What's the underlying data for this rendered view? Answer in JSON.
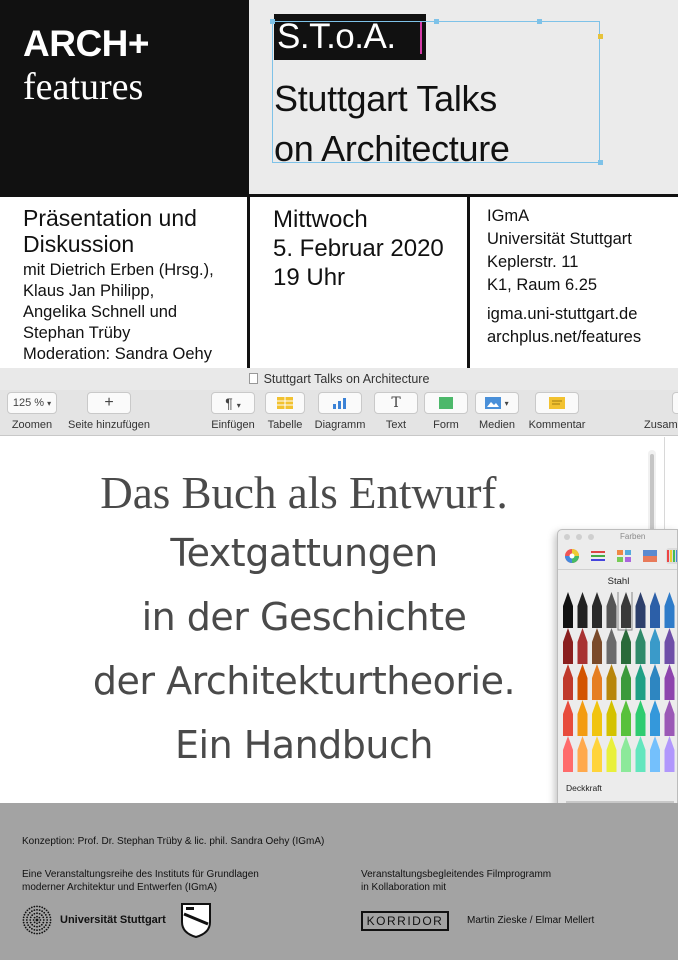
{
  "poster": {
    "brand": {
      "main": "ARCH+",
      "sub": "features"
    },
    "series": {
      "abbr": "S.T.o.A.",
      "title_lines": [
        "Stuttgart Talks",
        "on Architecture"
      ]
    },
    "col1": {
      "heading_lines": [
        "Präsentation und",
        "Diskussion"
      ],
      "people_lines": [
        "mit Dietrich Erben (Hrsg.),",
        "Klaus Jan Philipp,",
        "Angelika Schnell und",
        "Stephan Trüby",
        "Moderation: Sandra Oehy"
      ]
    },
    "col2": {
      "lines": [
        "Mittwoch",
        "5. Februar 2020",
        "19 Uhr"
      ]
    },
    "col3": {
      "address_lines": [
        "IGmA",
        "Universität Stuttgart",
        "Keplerstr. 11",
        "K1, Raum 6.25"
      ],
      "web_lines": [
        "igma.uni-stuttgart.de",
        "archplus.net/features"
      ]
    }
  },
  "app": {
    "window_title": "Stuttgart Talks on Architecture",
    "toolbar": {
      "zoom": {
        "value": "125 %",
        "label": "Zoomen"
      },
      "add_page": {
        "glyph": "+",
        "label": "Seite hinzufügen"
      },
      "insert": {
        "glyph": "¶",
        "label": "Einfügen"
      },
      "table": {
        "label": "Tabelle"
      },
      "chart": {
        "label": "Diagramm"
      },
      "text": {
        "glyph": "T",
        "label": "Text"
      },
      "shape": {
        "label": "Form"
      },
      "media": {
        "label": "Medien"
      },
      "comment": {
        "label": "Kommentar"
      },
      "collaborate": {
        "label": "Zusam"
      }
    },
    "colors": {
      "window_title": "Farben",
      "selected_name": "Stahl",
      "opacity_label": "Deckkraft",
      "accent": "#7ec2e8",
      "cursor": "#d33ba6"
    }
  },
  "book": {
    "title": "Das Buch als Entwurf.",
    "subtitle_lines": [
      "Textgattungen",
      "in der Geschichte",
      "der Architekturtheorie.",
      "Ein Handbuch"
    ]
  },
  "footer": {
    "concept": "Konzeption: Prof. Dr. Stephan Trüby & lic. phil. Sandra Oehy (IGmA)",
    "series_lines": [
      "Eine Veranstaltungsreihe des Instituts für Grundlagen",
      "moderner Architektur und Entwerfen (IGmA)"
    ],
    "film_lines": [
      "Veranstaltungsbegleitendes Filmprogramm",
      "in Kollaboration mit"
    ],
    "university": "Universität Stuttgart",
    "korridor": "KORRIDOR",
    "credits": "Martin Zieske / Elmar Mellert"
  }
}
